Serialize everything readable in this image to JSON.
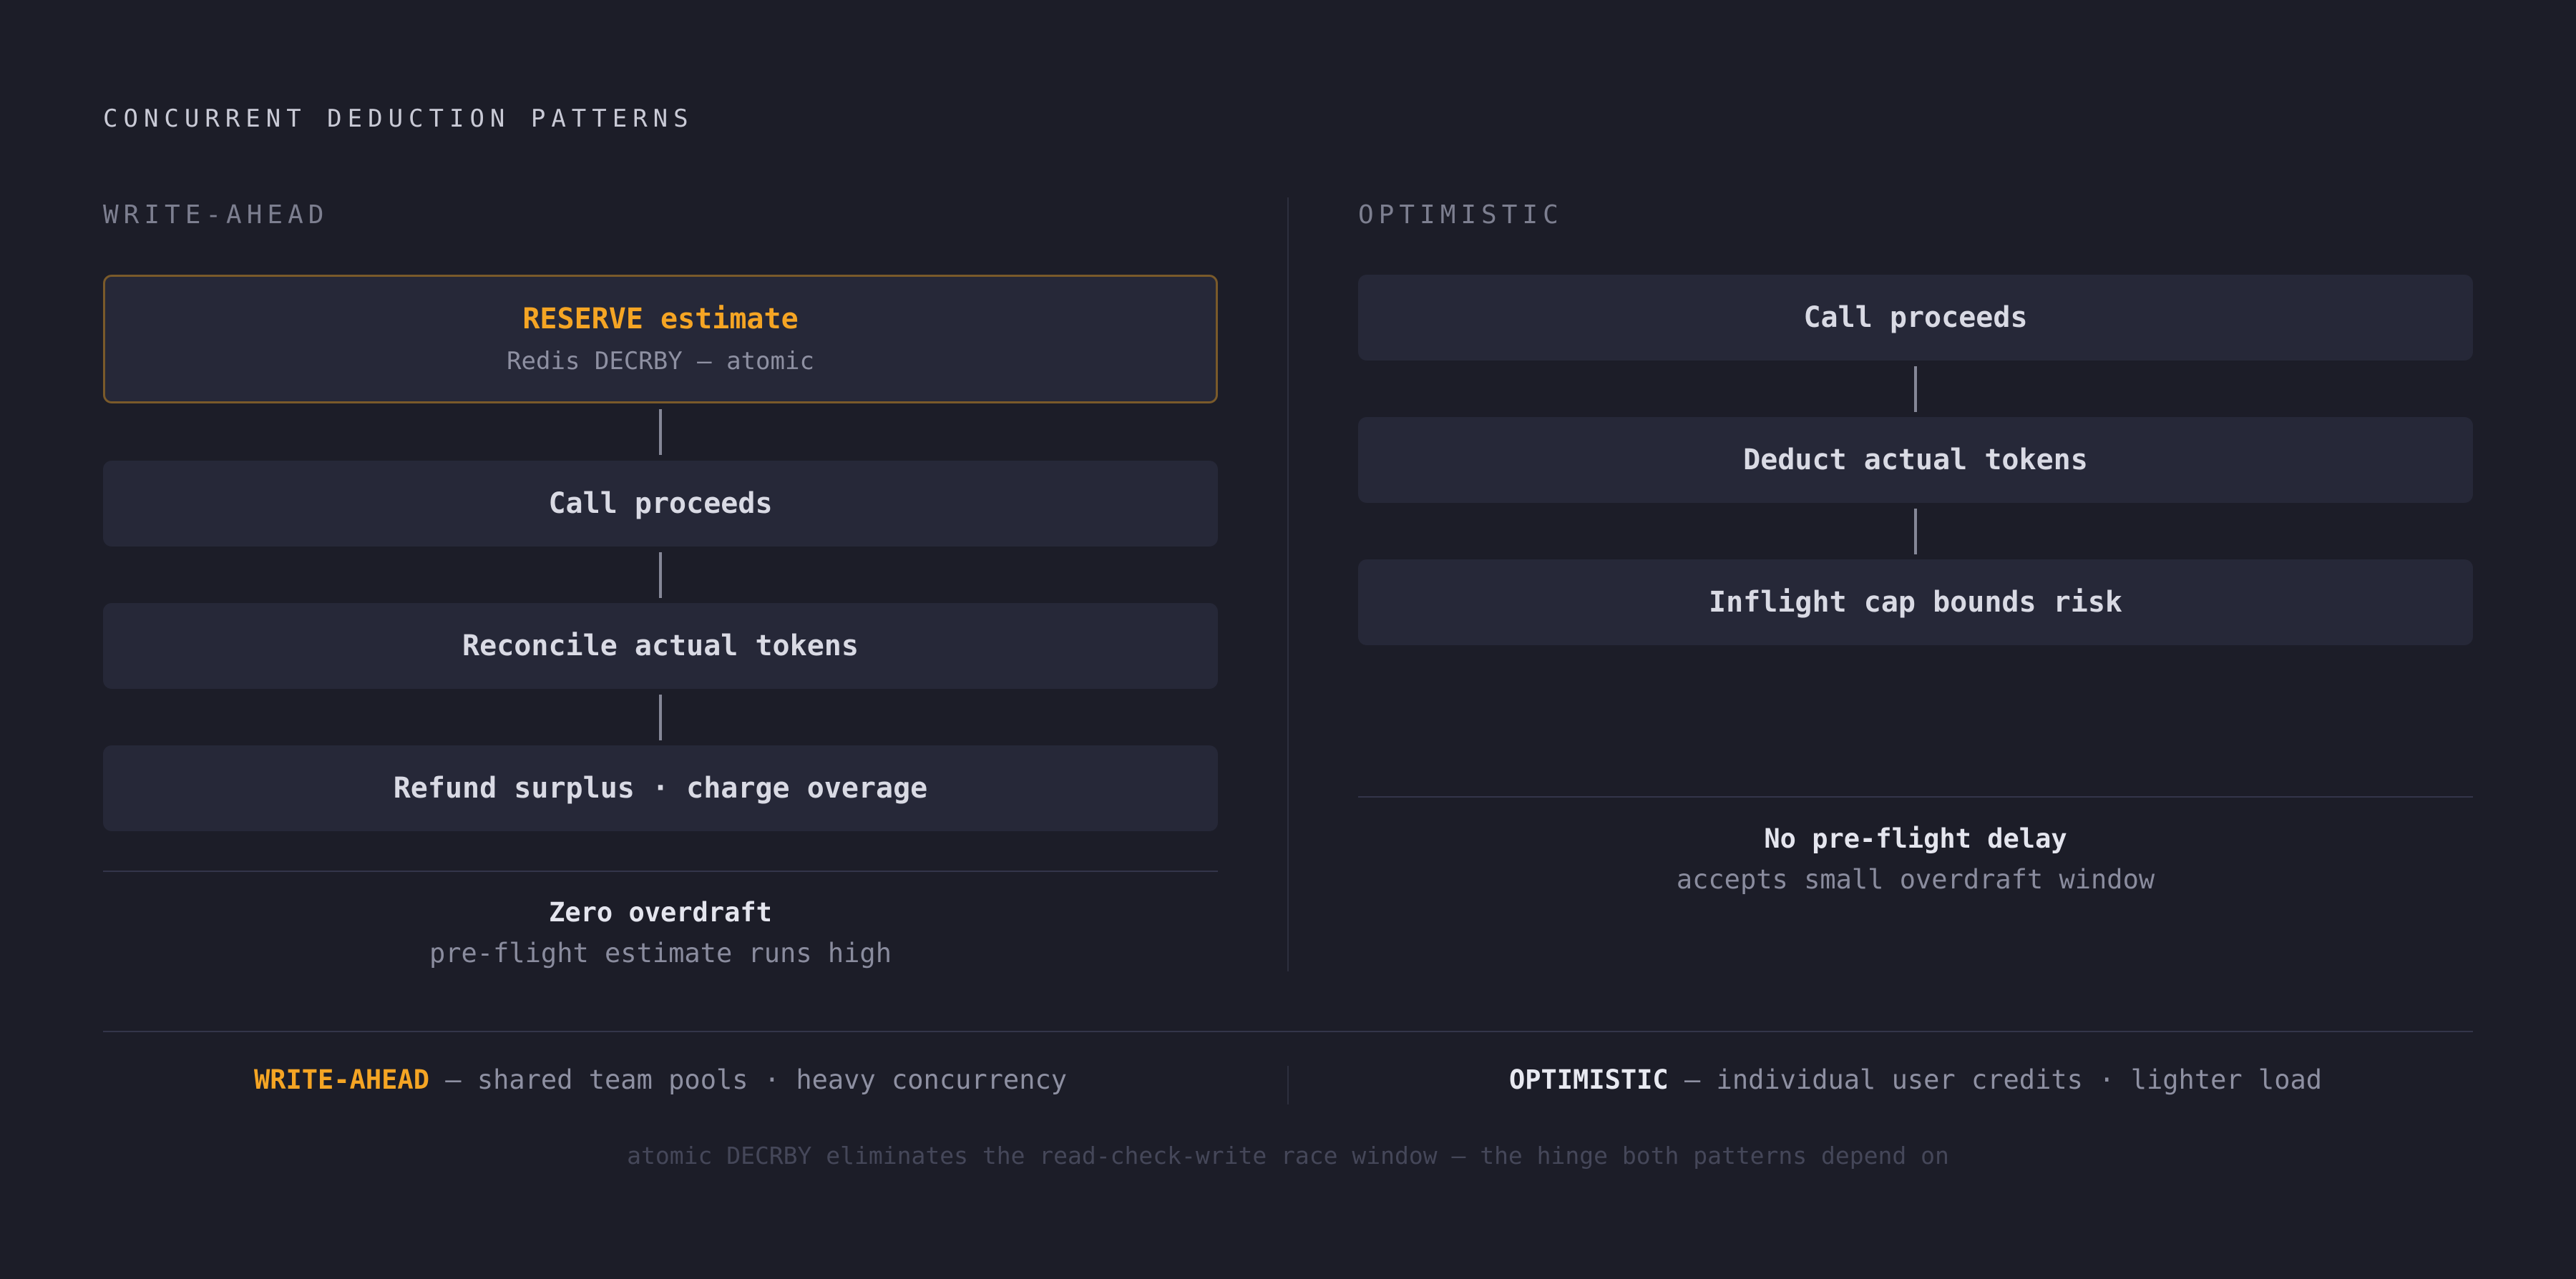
{
  "title": "CONCURRENT DEDUCTION PATTERNS",
  "write_ahead": {
    "heading": "WRITE-AHEAD",
    "steps": [
      {
        "label": "RESERVE estimate",
        "detail": "Redis DECRBY — atomic"
      },
      {
        "label": "Call proceeds"
      },
      {
        "label": "Reconcile actual tokens"
      },
      {
        "label": "Refund surplus · charge overage"
      }
    ],
    "outcome_title": "Zero overdraft",
    "outcome_detail": "pre-flight estimate runs high"
  },
  "optimistic": {
    "heading": "OPTIMISTIC",
    "steps": [
      {
        "label": "Call proceeds"
      },
      {
        "label": "Deduct actual tokens"
      },
      {
        "label": "Inflight cap bounds risk"
      }
    ],
    "outcome_title": "No pre-flight delay",
    "outcome_detail": "accepts small overdraft window"
  },
  "summary": {
    "left_name": "WRITE-AHEAD",
    "left_text": " — shared team pools · heavy concurrency",
    "right_name": "OPTIMISTIC",
    "right_text": " — individual user credits · lighter load"
  },
  "footnote": "atomic DECRBY eliminates the read-check-write race window — the hinge both patterns depend on",
  "colors": {
    "background": "#1c1d28",
    "box": "#262838",
    "accent": "#f5a524",
    "highlight_border": "#7a5a2a",
    "text": "#d9dae4",
    "muted": "#8e90a2"
  }
}
